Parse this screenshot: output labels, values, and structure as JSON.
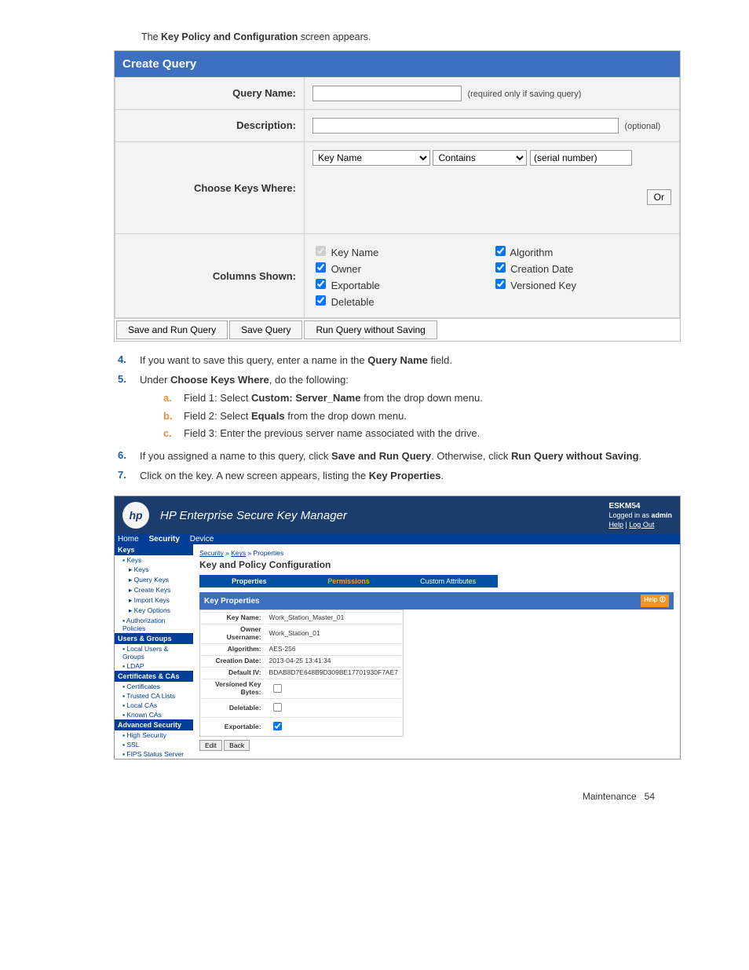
{
  "intro": {
    "pre": "The ",
    "bold": "Key Policy and Configuration",
    "post": " screen appears."
  },
  "cq": {
    "title": "Create Query",
    "labels": {
      "queryName": "Query Name:",
      "description": "Description:",
      "chooseKeys": "Choose Keys Where:",
      "columnsShown": "Columns Shown:"
    },
    "hints": {
      "queryName": "(required only if saving query)",
      "description": "(optional)"
    },
    "filter": {
      "field1_selected": "Key Name",
      "field2_selected": "Contains",
      "field3_placeholder": "(serial number)",
      "orBtn": "Or"
    },
    "columns": {
      "left": [
        {
          "label": "Key Name",
          "checked": true,
          "locked": true
        },
        {
          "label": "Owner",
          "checked": true,
          "locked": false
        },
        {
          "label": "Exportable",
          "checked": true,
          "locked": false
        },
        {
          "label": "Deletable",
          "checked": true,
          "locked": false
        }
      ],
      "right": [
        {
          "label": "Algorithm",
          "checked": true,
          "locked": false
        },
        {
          "label": "Creation Date",
          "checked": true,
          "locked": false
        },
        {
          "label": "Versioned Key",
          "checked": true,
          "locked": false
        }
      ]
    },
    "buttons": {
      "saveRun": "Save and Run Query",
      "save": "Save Query",
      "runNoSave": "Run Query without Saving"
    }
  },
  "steps": {
    "s4": {
      "num": "4.",
      "pre": "If you want to save this query, enter a name in the ",
      "bold": "Query Name",
      "post": " field."
    },
    "s5": {
      "num": "5.",
      "pre": "Under ",
      "bold": "Choose Keys Where",
      "post": ", do the following:"
    },
    "s5a": {
      "num": "a.",
      "pre": "Field 1: Select ",
      "bold": "Custom: Server_Name",
      "post": " from the drop down menu."
    },
    "s5b": {
      "num": "b.",
      "pre": "Field 2: Select ",
      "bold": "Equals",
      "post": " from the drop down menu."
    },
    "s5c": {
      "num": "c.",
      "text": "Field 3: Enter the previous server name associated with the drive."
    },
    "s6": {
      "num": "6.",
      "pre": "If you assigned a name to this query, click ",
      "bold1": "Save and Run Query",
      "mid": ". Otherwise, click ",
      "bold2": "Run Query without Saving",
      "post": "."
    },
    "s7": {
      "num": "7.",
      "pre": "Click on the key. A new screen appears, listing the ",
      "bold": "Key Properties",
      "post": "."
    }
  },
  "km": {
    "title": "HP Enterprise Secure Key Manager",
    "system": "ESKM54",
    "loggedPre": "Logged in as ",
    "loggedUser": "admin",
    "helpLabel": "Help",
    "logoutLabel": "Log Out",
    "nav": {
      "home": "Home",
      "security": "Security",
      "device": "Device"
    },
    "side": {
      "keys": "Keys",
      "keysItems": {
        "keys": "Keys",
        "keysSub": "Keys",
        "query": "Query Keys",
        "create": "Create Keys",
        "import": "Import Keys",
        "options": "Key Options",
        "auth": "Authorization Policies"
      },
      "users": "Users & Groups",
      "usersItems": {
        "local": "Local Users & Groups",
        "ldap": "LDAP"
      },
      "cas": "Certificates & CAs",
      "casItems": {
        "certs": "Certificates",
        "trusted": "Trusted CA Lists",
        "local": "Local CAs",
        "known": "Known CAs"
      },
      "adv": "Advanced Security",
      "advItems": {
        "high": "High Security",
        "ssl": "SSL",
        "fips": "FIPS Status Server"
      }
    },
    "crumb": {
      "a": "Security",
      "b": "Keys",
      "c": "Properties"
    },
    "pageTitle": "Key and Policy Configuration",
    "tabs": {
      "prop": "Properties",
      "perm": "Permissions",
      "custom": "Custom Attributes"
    },
    "panelHead": "Key Properties",
    "help": "Help",
    "props": {
      "keyNameLbl": "Key Name:",
      "keyName": "Work_Station_Master_01",
      "ownerLbl": "Owner Username:",
      "owner": "Work_Station_01",
      "algLbl": "Algorithm:",
      "alg": "AES-256",
      "cdateLbl": "Creation Date:",
      "cdate": "2013-04-25 13:41:34",
      "ivLbl": "Default IV:",
      "iv": "BDAB8D7E648B9D309BE17701930F7AE7",
      "vkbLbl": "Versioned Key Bytes:",
      "vkb": false,
      "delLbl": "Deletable:",
      "del": false,
      "expLbl": "Exportable:",
      "exp": true
    },
    "btns": {
      "edit": "Edit",
      "back": "Back"
    }
  },
  "footer": {
    "label": "Maintenance",
    "page": "54"
  }
}
